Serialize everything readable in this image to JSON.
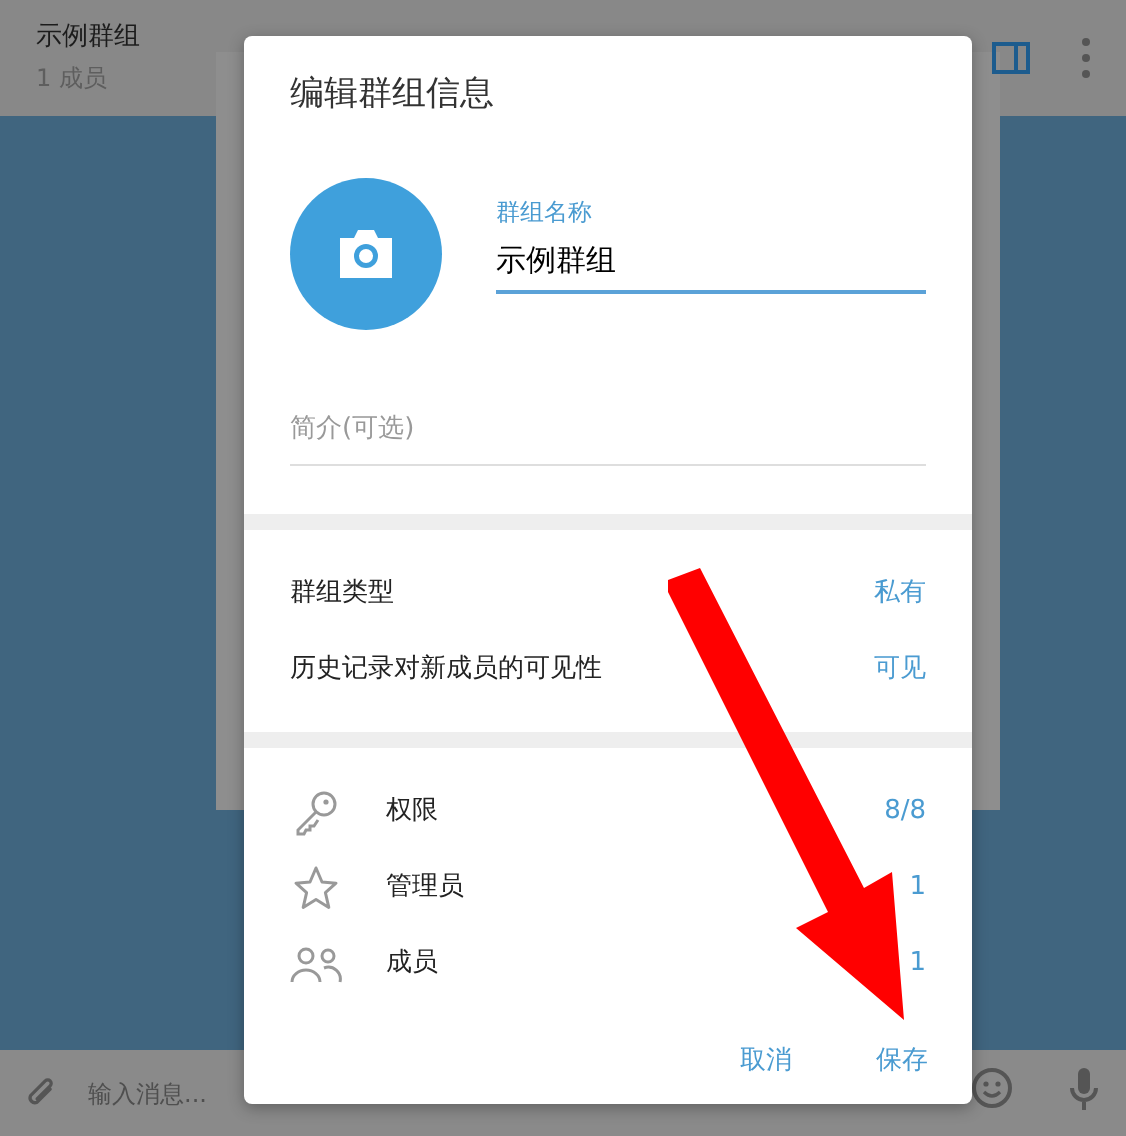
{
  "header": {
    "title": "示例群组",
    "subtitle": "1 成员"
  },
  "composer": {
    "placeholder": "输入消息..."
  },
  "dialog": {
    "title": "编辑群组信息",
    "name_field": {
      "label": "群组名称",
      "value": "示例群组"
    },
    "description_field": {
      "placeholder": "简介(可选)"
    },
    "settings": [
      {
        "label": "群组类型",
        "value": "私有"
      },
      {
        "label": "历史记录对新成员的可见性",
        "value": "可见"
      }
    ],
    "counters": [
      {
        "kind": "key",
        "label": "权限",
        "value": "8/8"
      },
      {
        "kind": "star",
        "label": "管理员",
        "value": "1"
      },
      {
        "kind": "people",
        "label": "成员",
        "value": "1"
      }
    ],
    "buttons": [
      "取消",
      "保存"
    ]
  }
}
